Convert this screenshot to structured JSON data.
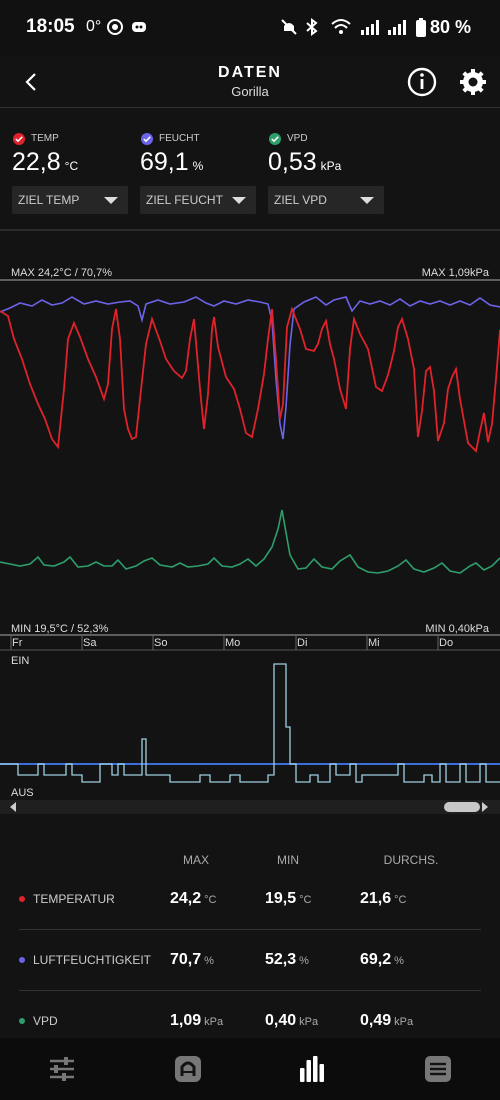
{
  "status_bar": {
    "time": "18:05",
    "temperature": "0°",
    "battery": "80 %"
  },
  "header": {
    "title": "DATEN",
    "subtitle": "Gorilla"
  },
  "metrics": [
    {
      "label": "TEMP",
      "value": "22,8",
      "unit": "°C",
      "target": "ZIEL TEMP",
      "color": "#e0222b"
    },
    {
      "label": "FEUCHT",
      "value": "69,1",
      "unit": "%",
      "target": "ZIEL FEUCHT",
      "color": "#6c63e8"
    },
    {
      "label": "VPD",
      "value": "0,53",
      "unit": "kPa",
      "target": "ZIEL VPD",
      "color": "#2e9e6b"
    }
  ],
  "chart": {
    "max_left": "MAX 24,2°C / 70,7%",
    "max_right": "MAX 1,09kPa",
    "min_left": "MIN 19,5°C / 52,3%",
    "min_right": "MIN 0,40kPa",
    "days": [
      "Fr",
      "Sa",
      "So",
      "Mo",
      "Di",
      "Mi",
      "Do"
    ],
    "switch_on": "EIN",
    "switch_off": "AUS"
  },
  "chart_data": {
    "type": "line",
    "series": [
      {
        "name": "TEMP",
        "color": "#e0222b"
      },
      {
        "name": "FEUCHT",
        "color": "#6c63e8"
      },
      {
        "name": "VPD",
        "color": "#2e9e6b"
      }
    ]
  },
  "stats": {
    "headers": [
      "MAX",
      "MIN",
      "DURCHS."
    ],
    "rows": [
      {
        "label": "TEMPERATUR",
        "color": "#e0222b",
        "max": "24,2",
        "min": "19,5",
        "avg": "21,6",
        "unit": "°C"
      },
      {
        "label": "LUFTFEUCHTIGKEIT",
        "color": "#6c63e8",
        "max": "70,7",
        "min": "52,3",
        "avg": "69,2",
        "unit": "%"
      },
      {
        "label": "VPD",
        "color": "#2e9e6b",
        "max": "1,09",
        "min": "0,40",
        "avg": "0,49",
        "unit": "kPa"
      }
    ]
  }
}
